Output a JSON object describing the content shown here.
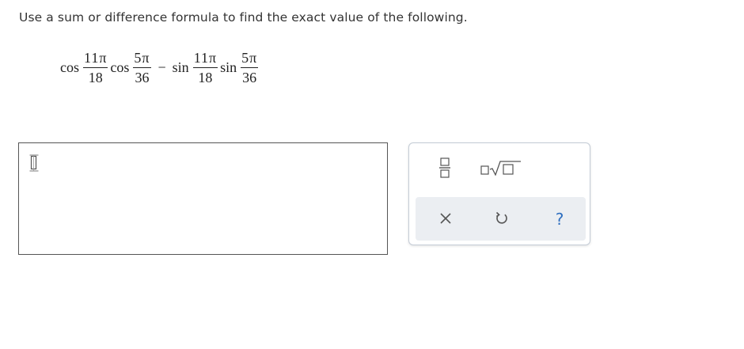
{
  "question": {
    "prompt": "Use a sum or difference formula to find the exact value of the following."
  },
  "expression": {
    "term1_fn": "cos",
    "term1_num": "11π",
    "term1_den": "18",
    "term2_fn": "cos",
    "term2_num": "5π",
    "term2_den": "36",
    "operator": "−",
    "term3_fn": "sin",
    "term3_num": "11π",
    "term3_den": "18",
    "term4_fn": "sin",
    "term4_num": "5π",
    "term4_den": "36"
  },
  "answer": {
    "value": ""
  },
  "toolbox": {
    "buttons": [
      "fraction-icon",
      "nth-root-icon",
      "clear-icon",
      "undo-icon",
      "help-icon"
    ],
    "help_label": "?"
  },
  "colors": {
    "text": "#333333",
    "accent": "#2f6fc0",
    "toolbar_row": "#ebeef2",
    "toolbox_border": "#c4ccd6",
    "answer_border": "#555555"
  }
}
